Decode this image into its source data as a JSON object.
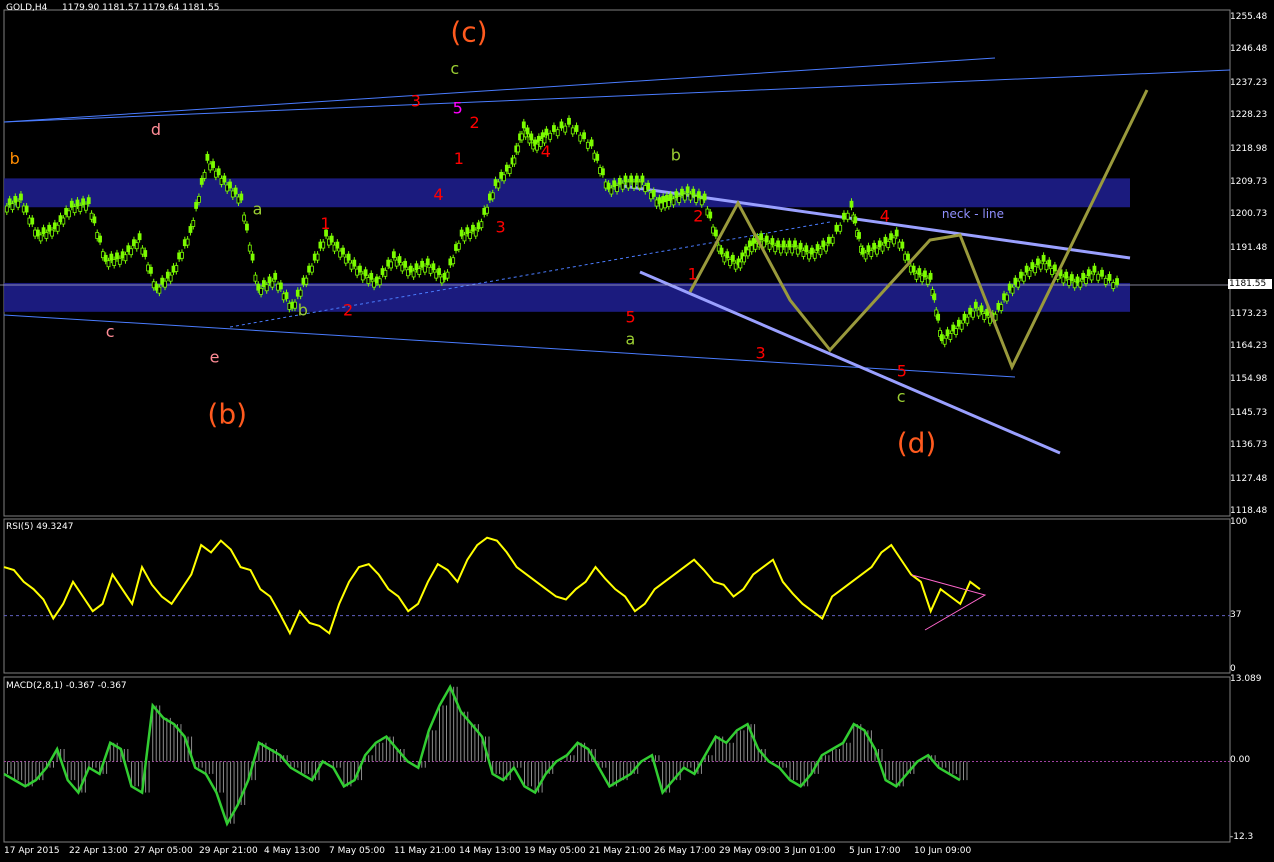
{
  "header": {
    "symbol": "GOLD,H4",
    "ohlc": "1179.90 1181.57 1179.64 1181.55",
    "rsi": "RSI(5) 49.3247",
    "macd": "MACD(2,8,1) -0.367 -0.367"
  },
  "current_price": "1181.55",
  "chart_data": [
    {
      "type": "candlestick",
      "title": "GOLD,H4",
      "ylim": [
        1118.48,
        1255.48
      ],
      "y_ticks": [
        "1255.48",
        "1246.48",
        "1237.23",
        "1228.23",
        "1218.98",
        "1209.73",
        "1200.73",
        "1191.48",
        "1181.55",
        "1173.23",
        "1164.23",
        "1154.98",
        "1145.73",
        "1136.73",
        "1127.48",
        "1118.48"
      ],
      "x_ticks": [
        "17 Apr 2015",
        "22 Apr 13:00",
        "27 Apr 05:00",
        "29 Apr 21:00",
        "4 May 13:00",
        "7 May 05:00",
        "11 May 21:00",
        "14 May 13:00",
        "19 May 05:00",
        "21 May 21:00",
        "26 May 17:00",
        "29 May 09:00",
        "3 Jun 01:00",
        "5 Jun 17:00",
        "10 Jun 09:00"
      ],
      "close_path": [
        [
          0,
          1203
        ],
        [
          0.015,
          1205
        ],
        [
          0.03,
          1195
        ],
        [
          0.045,
          1197
        ],
        [
          0.06,
          1203
        ],
        [
          0.075,
          1204
        ],
        [
          0.09,
          1188
        ],
        [
          0.105,
          1189
        ],
        [
          0.12,
          1194
        ],
        [
          0.135,
          1180
        ],
        [
          0.15,
          1185
        ],
        [
          0.165,
          1196
        ],
        [
          0.18,
          1216
        ],
        [
          0.195,
          1210
        ],
        [
          0.21,
          1205
        ],
        [
          0.225,
          1180
        ],
        [
          0.24,
          1183
        ],
        [
          0.255,
          1175
        ],
        [
          0.27,
          1185
        ],
        [
          0.285,
          1195
        ],
        [
          0.3,
          1190
        ],
        [
          0.315,
          1185
        ],
        [
          0.33,
          1182
        ],
        [
          0.345,
          1189
        ],
        [
          0.36,
          1185
        ],
        [
          0.375,
          1187
        ],
        [
          0.39,
          1183
        ],
        [
          0.405,
          1195
        ],
        [
          0.42,
          1197
        ],
        [
          0.435,
          1209
        ],
        [
          0.45,
          1215
        ],
        [
          0.46,
          1225
        ],
        [
          0.47,
          1220
        ],
        [
          0.48,
          1223
        ],
        [
          0.5,
          1226
        ],
        [
          0.52,
          1220
        ],
        [
          0.535,
          1208
        ],
        [
          0.55,
          1210
        ],
        [
          0.565,
          1210
        ],
        [
          0.58,
          1204
        ],
        [
          0.59,
          1205
        ],
        [
          0.605,
          1207
        ],
        [
          0.62,
          1205
        ],
        [
          0.635,
          1190
        ],
        [
          0.65,
          1187
        ],
        [
          0.66,
          1192
        ],
        [
          0.67,
          1194
        ],
        [
          0.685,
          1192
        ],
        [
          0.7,
          1192
        ],
        [
          0.715,
          1190
        ],
        [
          0.73,
          1193
        ],
        [
          0.75,
          1203
        ],
        [
          0.76,
          1190
        ],
        [
          0.775,
          1192
        ],
        [
          0.79,
          1195
        ],
        [
          0.805,
          1185
        ],
        [
          0.82,
          1183
        ],
        [
          0.83,
          1166
        ],
        [
          0.845,
          1170
        ],
        [
          0.86,
          1175
        ],
        [
          0.875,
          1172
        ],
        [
          0.89,
          1180
        ],
        [
          0.905,
          1185
        ],
        [
          0.92,
          1188
        ],
        [
          0.935,
          1184
        ],
        [
          0.95,
          1182
        ],
        [
          0.965,
          1185
        ],
        [
          0.985,
          1181.55
        ]
      ],
      "support_zones": [
        [
          1203,
          1211
        ],
        [
          1174,
          1182
        ]
      ],
      "projection_path": [
        [
          0.785,
          1191
        ],
        [
          0.83,
          1158
        ],
        [
          0.86,
          1194
        ],
        [
          0.94,
          1150
        ],
        [
          0.97,
          1226
        ]
      ],
      "wave_labels": [
        {
          "t": "(c)",
          "c": "#ff5a1e",
          "x": 0.395,
          "y": 1249
        },
        {
          "t": "(b)",
          "c": "#ff5a1e",
          "x": 0.18,
          "y": 1143
        },
        {
          "t": "(d)",
          "c": "#ff5a1e",
          "x": 0.79,
          "y": 1135
        },
        {
          "t": "c",
          "c": "#9acd32",
          "x": 0.395,
          "y": 1240
        },
        {
          "t": "5",
          "c": "#ff00ff",
          "x": 0.397,
          "y": 1229
        },
        {
          "t": "3",
          "c": "#ff0000",
          "x": 0.36,
          "y": 1231
        },
        {
          "t": "2",
          "c": "#ff0000",
          "x": 0.412,
          "y": 1225
        },
        {
          "t": "1",
          "c": "#ff0000",
          "x": 0.398,
          "y": 1215
        },
        {
          "t": "4",
          "c": "#ff0000",
          "x": 0.38,
          "y": 1205
        },
        {
          "t": "4",
          "c": "#ff0000",
          "x": 0.475,
          "y": 1217
        },
        {
          "t": "3",
          "c": "#ff0000",
          "x": 0.435,
          "y": 1196
        },
        {
          "t": "b",
          "c": "#ff8c00",
          "x": 0.005,
          "y": 1215
        },
        {
          "t": "d",
          "c": "#ff8c96",
          "x": 0.13,
          "y": 1223
        },
        {
          "t": "c",
          "c": "#ff8c96",
          "x": 0.09,
          "y": 1167
        },
        {
          "t": "e",
          "c": "#ff8c96",
          "x": 0.182,
          "y": 1160
        },
        {
          "t": "a",
          "c": "#9acd32",
          "x": 0.22,
          "y": 1201
        },
        {
          "t": "b",
          "c": "#9acd32",
          "x": 0.26,
          "y": 1173
        },
        {
          "t": "1",
          "c": "#ff0000",
          "x": 0.28,
          "y": 1197
        },
        {
          "t": "2",
          "c": "#ff0000",
          "x": 0.3,
          "y": 1173
        },
        {
          "t": "b",
          "c": "#9acd32",
          "x": 0.59,
          "y": 1216
        },
        {
          "t": "a",
          "c": "#9acd32",
          "x": 0.55,
          "y": 1165
        },
        {
          "t": "5",
          "c": "#ff0000",
          "x": 0.55,
          "y": 1171
        },
        {
          "t": "2",
          "c": "#ff0000",
          "x": 0.61,
          "y": 1199
        },
        {
          "t": "1",
          "c": "#ff0000",
          "x": 0.605,
          "y": 1183
        },
        {
          "t": "3",
          "c": "#ff0000",
          "x": 0.665,
          "y": 1161
        },
        {
          "t": "4",
          "c": "#ff0000",
          "x": 0.775,
          "y": 1199
        },
        {
          "t": "5",
          "c": "#ff0000",
          "x": 0.79,
          "y": 1156
        },
        {
          "t": "c",
          "c": "#9acd32",
          "x": 0.79,
          "y": 1149
        },
        {
          "t": "neck - line",
          "c": "#9090ff",
          "x": 0.83,
          "y": 1200
        }
      ]
    },
    {
      "type": "line",
      "title": "RSI(5) 49.3247",
      "ylim": [
        0,
        100
      ],
      "y_ticks": [
        "100",
        "37",
        "0"
      ],
      "values": [
        70,
        68,
        60,
        55,
        48,
        35,
        45,
        60,
        50,
        40,
        45,
        65,
        55,
        45,
        70,
        58,
        50,
        45,
        55,
        65,
        85,
        80,
        88,
        82,
        70,
        68,
        55,
        50,
        38,
        25,
        40,
        32,
        30,
        25,
        45,
        60,
        70,
        72,
        65,
        55,
        50,
        40,
        45,
        60,
        72,
        68,
        60,
        75,
        85,
        90,
        88,
        80,
        70,
        65,
        60,
        55,
        50,
        48,
        55,
        60,
        70,
        62,
        55,
        50,
        40,
        45,
        55,
        60,
        65,
        70,
        75,
        68,
        60,
        58,
        50,
        55,
        65,
        70,
        75,
        60,
        52,
        45,
        40,
        35,
        50,
        55,
        60,
        65,
        70,
        80,
        85,
        75,
        65,
        60,
        40,
        55,
        50,
        45,
        60,
        55
      ]
    },
    {
      "type": "bar",
      "title": "MACD(2,8,1) -0.367 -0.367",
      "ylim": [
        -12.3,
        13.089
      ],
      "y_ticks": [
        "13.089",
        "0.00",
        "-12.3"
      ],
      "values": [
        -2,
        -3,
        -4,
        -3,
        -1,
        2,
        -3,
        -5,
        -1,
        -2,
        3,
        2,
        -4,
        -5,
        9,
        7,
        6,
        4,
        -1,
        -2,
        -5,
        -10,
        -7,
        -3,
        3,
        2,
        1,
        -1,
        -2,
        -3,
        0,
        -1,
        -4,
        -3,
        1,
        3,
        4,
        2,
        0,
        -1,
        5,
        9,
        12,
        8,
        6,
        4,
        -2,
        -3,
        -1,
        -4,
        -5,
        -2,
        0,
        1,
        3,
        2,
        -1,
        -4,
        -3,
        -2,
        0,
        1,
        -5,
        -3,
        -1,
        -2,
        1,
        4,
        3,
        5,
        6,
        2,
        0,
        -1,
        -3,
        -4,
        -2,
        1,
        2,
        3,
        6,
        5,
        2,
        -3,
        -4,
        -2,
        0,
        1,
        -1,
        -2,
        -3
      ]
    }
  ]
}
